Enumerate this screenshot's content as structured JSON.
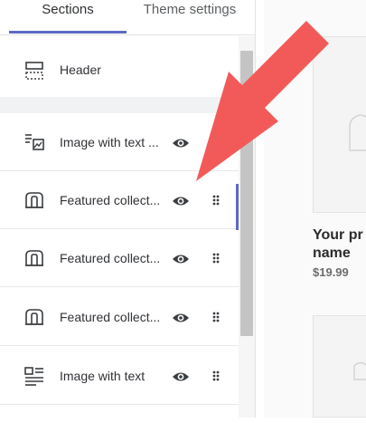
{
  "tabs": [
    {
      "label": "Sections",
      "active": true
    },
    {
      "label": "Theme settings",
      "active": false
    }
  ],
  "sections": [
    {
      "label": "Header",
      "icon": "header-layout-icon"
    },
    {
      "label": "Image with text ...",
      "icon": "image-with-text-icon",
      "visible": true
    },
    {
      "label": "Featured collect...",
      "icon": "collection-icon",
      "visible": true,
      "selected": true
    },
    {
      "label": "Featured collect...",
      "icon": "collection-icon",
      "visible": true
    },
    {
      "label": "Featured collect...",
      "icon": "collection-icon",
      "visible": true
    },
    {
      "label": "Image with text",
      "icon": "text-columns-icon",
      "visible": true
    }
  ],
  "preview": {
    "product_name": "Your pr name",
    "product_price": "$19.99"
  },
  "colors": {
    "accent": "#5c6ac4",
    "arrow": "#f25a5a"
  }
}
